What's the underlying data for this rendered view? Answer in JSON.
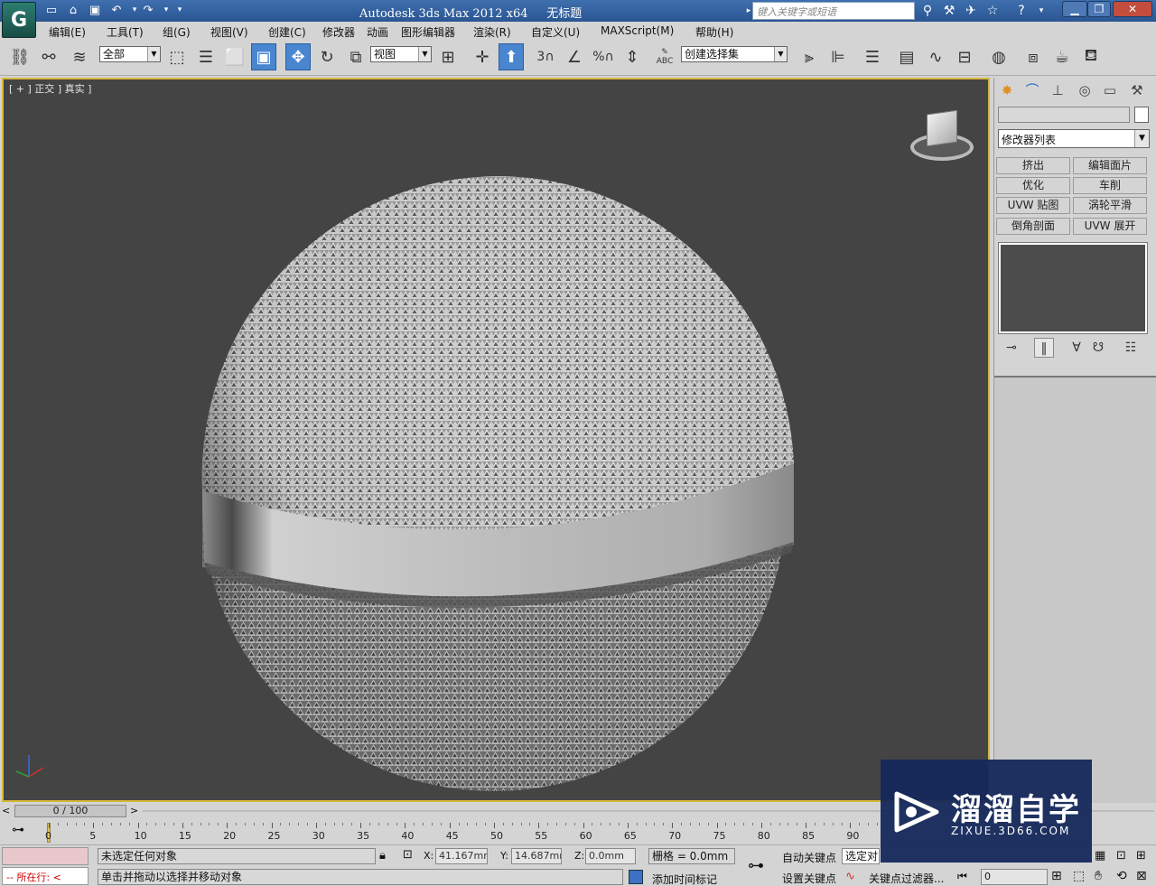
{
  "title_bar": {
    "app_name": "Autodesk 3ds Max  2012 x64",
    "document": "无标题",
    "search_placeholder": "键入关键字或短语"
  },
  "menu": [
    "编辑(E)",
    "工具(T)",
    "组(G)",
    "视图(V)",
    "创建(C)",
    "修改器",
    "动画",
    "图形编辑器",
    "渲染(R)",
    "自定义(U)",
    "MAXScript(M)",
    "帮助(H)"
  ],
  "toolbar": {
    "selection_filter": "全部",
    "reference_coord": "视图",
    "named_selection": "创建选择集",
    "snap_3": "3",
    "percent_snap": "%",
    "abc": "ABC"
  },
  "viewport": {
    "label_parts": [
      "[",
      "+",
      "]",
      "正交",
      "]",
      "真实",
      "]"
    ],
    "label": "[ + ] 正交 ] 真实 ]",
    "background": "#444444",
    "border_color": "#d6b83a"
  },
  "command_panel": {
    "modifier_list": "修改器列表",
    "modifier_buttons": [
      "挤出",
      "编辑面片",
      "优化",
      "车削",
      "UVW 贴图",
      "涡轮平滑",
      "倒角剖面",
      "UVW 展开"
    ]
  },
  "timeline": {
    "frame_counter": "0 / 100",
    "ticks": [
      "0",
      "5",
      "10",
      "15",
      "20",
      "25",
      "30",
      "35",
      "40",
      "45",
      "50",
      "55",
      "60",
      "65",
      "70",
      "75",
      "80",
      "85",
      "90"
    ]
  },
  "status": {
    "script_label": "所在行:",
    "selection_status": "未选定任何对象",
    "prompt": "单击并拖动以选择并移动对象",
    "x_label": "X:",
    "x_value": "41.167mm",
    "y_label": "Y:",
    "y_value": "14.687mm",
    "z_label": "Z:",
    "z_value": "0.0mm",
    "grid": "栅格 = 0.0mm",
    "add_time_tag": "添加时间标记",
    "auto_key": "自动关键点",
    "set_key": "设置关键点",
    "selected_dropdown": "选定对",
    "key_filters": "关键点过滤器...",
    "frame_field": "0"
  },
  "watermark": {
    "brand": "溜溜自学",
    "url": "ZIXUE.3D66.COM"
  }
}
